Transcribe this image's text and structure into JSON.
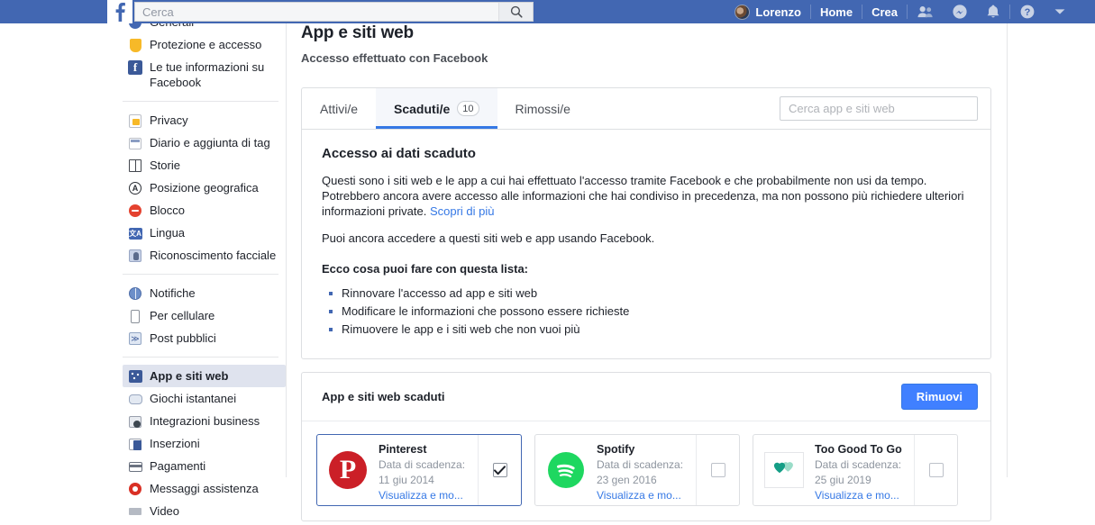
{
  "topnav": {
    "logo_letter": "f",
    "search_placeholder": "Cerca",
    "search_value": "",
    "search_icon": "search-icon",
    "profile_name": "Lorenzo",
    "home_label": "Home",
    "create_label": "Crea",
    "friends_icon": "friends-icon",
    "messenger_icon": "messenger-icon",
    "notifications_icon": "bell-icon",
    "help_icon": "help-circle-icon",
    "account_icon": "chevron-down-icon",
    "bg_color": "#4267b2"
  },
  "sidebar": {
    "groups": [
      {
        "items": [
          {
            "label": "Generali",
            "icon": "gear-icon",
            "active": false,
            "partial": true
          },
          {
            "label": "Protezione e accesso",
            "icon": "shield-icon",
            "active": false
          },
          {
            "label": "Le tue informazioni su Facebook",
            "icon": "facebook-icon",
            "active": false
          }
        ]
      },
      {
        "items": [
          {
            "label": "Privacy",
            "icon": "lock-icon",
            "active": false
          },
          {
            "label": "Diario e aggiunta di tag",
            "icon": "timeline-icon",
            "active": false
          },
          {
            "label": "Storie",
            "icon": "stories-book-icon",
            "active": false
          },
          {
            "label": "Posizione geografica",
            "icon": "location-icon",
            "active": false
          },
          {
            "label": "Blocco",
            "icon": "block-icon",
            "active": false
          },
          {
            "label": "Lingua",
            "icon": "language-icon",
            "active": false
          },
          {
            "label": "Riconoscimento facciale",
            "icon": "face-recognition-icon",
            "active": false
          }
        ]
      },
      {
        "items": [
          {
            "label": "Notifiche",
            "icon": "globe-icon",
            "active": false
          },
          {
            "label": "Per cellulare",
            "icon": "mobile-icon",
            "active": false
          },
          {
            "label": "Post pubblici",
            "icon": "rss-icon",
            "active": false
          }
        ]
      },
      {
        "items": [
          {
            "label": "App e siti web",
            "icon": "apps-icon",
            "active": true
          },
          {
            "label": "Giochi istantanei",
            "icon": "gamepad-icon",
            "active": false
          },
          {
            "label": "Integrazioni business",
            "icon": "business-icon",
            "active": false
          },
          {
            "label": "Inserzioni",
            "icon": "ads-icon",
            "active": false
          },
          {
            "label": "Pagamenti",
            "icon": "payments-icon",
            "active": false
          },
          {
            "label": "Messaggi assistenza",
            "icon": "support-icon",
            "active": false
          },
          {
            "label": "Video",
            "icon": "video-icon",
            "active": false,
            "partial": true
          }
        ]
      }
    ]
  },
  "main": {
    "title": "App e siti web",
    "subtitle": "Accesso effettuato con Facebook",
    "tabs": [
      {
        "label": "Attivi/e",
        "badge": "",
        "active": false
      },
      {
        "label": "Scaduti/e",
        "badge": "10",
        "active": true
      },
      {
        "label": "Rimossi/e",
        "badge": "",
        "active": false
      }
    ],
    "tab_search_placeholder": "Cerca app e siti web",
    "tab_search_value": "",
    "section_title": "Accesso ai dati scaduto",
    "paragraph_1": "Questi sono i siti web e le app a cui hai effettuato l'accesso tramite Facebook e che probabilmente non usi da tempo. Potrebbero ancora avere accesso alle informazioni che hai condiviso in precedenza, ma non possono più richiedere ulteriori informazioni private.",
    "paragraph_1_link": "Scopri di più",
    "paragraph_2": "Puoi ancora accedere a questi siti web e app usando Facebook.",
    "lead": "Ecco cosa puoi fare con questa lista:",
    "bullets": [
      "Rinnovare l'accesso ad app e siti web",
      "Modificare le informazioni che possono essere richieste",
      "Rimuovere le app e i siti web che non vuoi più"
    ]
  },
  "apps_list": {
    "header_title": "App e siti web scaduti",
    "remove_button": "Rimuovi",
    "expiry_label": "Data di scadenza:",
    "view_link": "Visualizza e mo...",
    "apps": [
      {
        "name": "Pinterest",
        "expiry_date": "11 giu 2014",
        "logo": "pinterest-logo",
        "selected": true
      },
      {
        "name": "Spotify",
        "expiry_date": "23 gen 2016",
        "logo": "spotify-logo",
        "selected": false
      },
      {
        "name": "Too Good To Go",
        "expiry_date": "25 giu 2019",
        "logo": "too-good-to-go-logo",
        "selected": false
      }
    ]
  },
  "colors": {
    "brand_blue": "#4267b2",
    "accent_blue": "#3578e5",
    "button_blue": "#4080ff",
    "active_item_bg": "#dfe3ee"
  }
}
